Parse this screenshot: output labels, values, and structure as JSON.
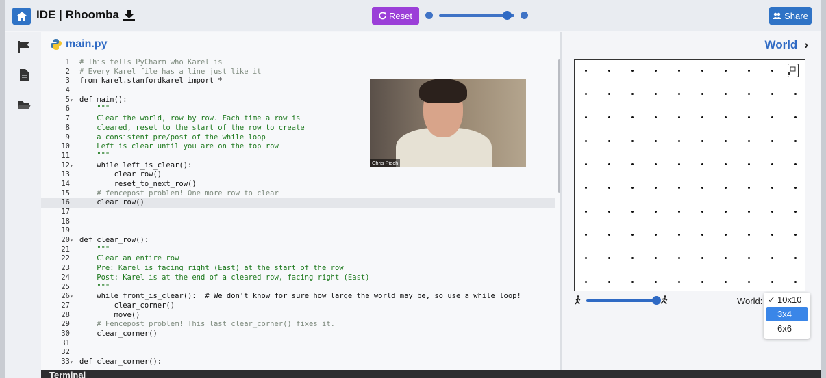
{
  "topbar": {
    "title": "IDE | Rhoomba",
    "reset_label": "Reset",
    "share_label": "Share",
    "speed_level": 0.9
  },
  "editor": {
    "file_name": "main.py",
    "lines": [
      {
        "n": "1",
        "fold": "",
        "text": "# This tells PyCharm who Karel is",
        "kind": "comment"
      },
      {
        "n": "2",
        "fold": "",
        "text": "# Every Karel file has a line just like it",
        "kind": "comment"
      },
      {
        "n": "3",
        "fold": "",
        "text": "from karel.stanfordkarel import *",
        "kind": "code"
      },
      {
        "n": "4",
        "fold": "",
        "text": "",
        "kind": "code"
      },
      {
        "n": "5",
        "fold": "▾",
        "text": "def main():",
        "kind": "code"
      },
      {
        "n": "6",
        "fold": "",
        "text": "    \"\"\"",
        "kind": "doc"
      },
      {
        "n": "7",
        "fold": "",
        "text": "    Clear the world, row by row. Each time a row is",
        "kind": "doc"
      },
      {
        "n": "8",
        "fold": "",
        "text": "    cleared, reset to the start of the row to create",
        "kind": "doc"
      },
      {
        "n": "9",
        "fold": "",
        "text": "    a consistent pre/post of the while loop",
        "kind": "doc"
      },
      {
        "n": "10",
        "fold": "",
        "text": "    Left is clear until you are on the top row",
        "kind": "doc"
      },
      {
        "n": "11",
        "fold": "",
        "text": "    \"\"\"",
        "kind": "doc"
      },
      {
        "n": "12",
        "fold": "▾",
        "text": "    while left_is_clear():",
        "kind": "code"
      },
      {
        "n": "13",
        "fold": "",
        "text": "        clear_row()",
        "kind": "code"
      },
      {
        "n": "14",
        "fold": "",
        "text": "        reset_to_next_row()",
        "kind": "code"
      },
      {
        "n": "15",
        "fold": "",
        "text": "    # fencepost problem! One more row to clear",
        "kind": "comment"
      },
      {
        "n": "16",
        "fold": "",
        "text": "    clear_row()",
        "kind": "code",
        "active": true
      },
      {
        "n": "17",
        "fold": "",
        "text": "",
        "kind": "code"
      },
      {
        "n": "18",
        "fold": "",
        "text": "",
        "kind": "code"
      },
      {
        "n": "19",
        "fold": "",
        "text": "",
        "kind": "code"
      },
      {
        "n": "20",
        "fold": "▾",
        "text": "def clear_row():",
        "kind": "code"
      },
      {
        "n": "21",
        "fold": "",
        "text": "    \"\"\"",
        "kind": "doc"
      },
      {
        "n": "22",
        "fold": "",
        "text": "    Clear an entire row",
        "kind": "doc"
      },
      {
        "n": "23",
        "fold": "",
        "text": "    Pre: Karel is facing right (East) at the start of the row",
        "kind": "doc"
      },
      {
        "n": "24",
        "fold": "",
        "text": "    Post: Karel is at the end of a cleared row, facing right (East)",
        "kind": "doc"
      },
      {
        "n": "25",
        "fold": "",
        "text": "    \"\"\"",
        "kind": "doc"
      },
      {
        "n": "26",
        "fold": "▾",
        "text": "    while front_is_clear():  # We don't know for sure how large the world may be, so use a while loop!",
        "kind": "code"
      },
      {
        "n": "27",
        "fold": "",
        "text": "        clear_corner()",
        "kind": "code"
      },
      {
        "n": "28",
        "fold": "",
        "text": "        move()",
        "kind": "code"
      },
      {
        "n": "29",
        "fold": "",
        "text": "    # Fencepost problem! This last clear_corner() fixes it.",
        "kind": "comment"
      },
      {
        "n": "30",
        "fold": "",
        "text": "    clear_corner()",
        "kind": "code"
      },
      {
        "n": "31",
        "fold": "",
        "text": "",
        "kind": "code"
      },
      {
        "n": "32",
        "fold": "",
        "text": "",
        "kind": "code"
      },
      {
        "n": "33",
        "fold": "▾",
        "text": "def clear_corner():",
        "kind": "code"
      }
    ]
  },
  "video": {
    "name": "Chris Piech"
  },
  "world": {
    "title": "World",
    "rows": 10,
    "cols": 10,
    "select_label": "World:",
    "options": [
      "10x10",
      "3x4",
      "6x6"
    ],
    "selected": "10x10",
    "hovered": "3x4",
    "animation_level": 1.0
  },
  "terminal": {
    "label": "Terminal"
  },
  "colors": {
    "accent": "#2f73c6",
    "reset": "#9b3fd8",
    "docstring": "#1f7a1f"
  }
}
